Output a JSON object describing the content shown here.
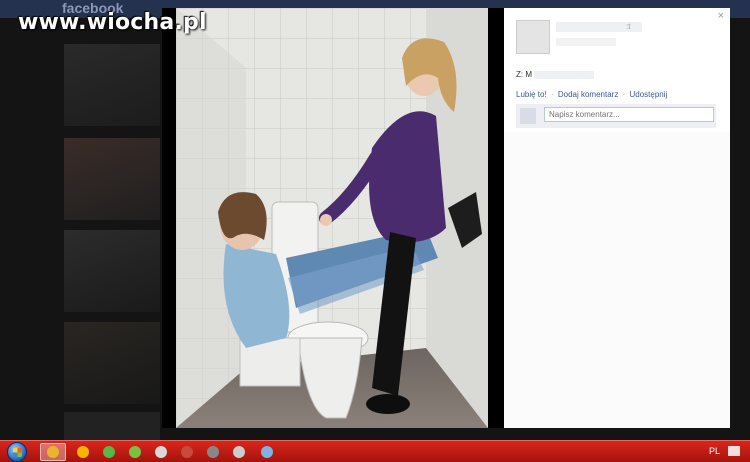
{
  "watermark": {
    "text": "www.wiocha.pl"
  },
  "background_page": {
    "logo": "facebook"
  },
  "lightbox": {
    "close_label": "×",
    "owner": {
      "tail": ":t"
    },
    "with_prefix": "Z:",
    "with_initial": "M",
    "actions": {
      "like": "Lubię to!",
      "comment": "Dodaj komentarz",
      "share": "Udostępnij",
      "separator": "·"
    },
    "comment_placeholder": "Napisz komentarz..."
  },
  "taskbar": {
    "lang": "PL",
    "items": [
      {
        "name": "chrome-icon",
        "color": "#e8b62a",
        "active": true
      },
      {
        "name": "sun-icon",
        "color": "#f7b500"
      },
      {
        "name": "utorrent-icon",
        "color": "#55b848"
      },
      {
        "name": "gadu-icon",
        "color": "#7ac142"
      },
      {
        "name": "media-icon",
        "color": "#d9d9d9"
      },
      {
        "name": "game-icon",
        "color": "#c74a3a"
      },
      {
        "name": "tool-icon",
        "color": "#888888"
      },
      {
        "name": "pen-icon",
        "color": "#cccccc"
      },
      {
        "name": "picture-icon",
        "color": "#7fb2e5"
      }
    ]
  }
}
